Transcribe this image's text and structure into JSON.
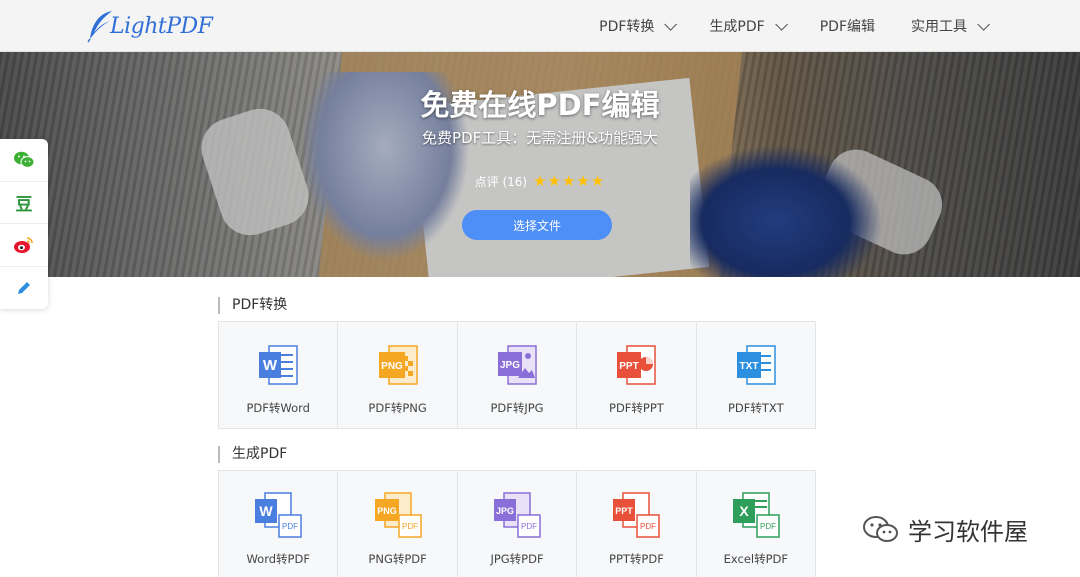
{
  "header": {
    "logo_text": "LightPDF",
    "nav": [
      {
        "label": "PDF转换",
        "has_dropdown": true
      },
      {
        "label": "生成PDF",
        "has_dropdown": true
      },
      {
        "label": "PDF编辑",
        "has_dropdown": false
      },
      {
        "label": "实用工具",
        "has_dropdown": true
      }
    ]
  },
  "hero": {
    "title": "免费在线PDF编辑",
    "subtitle": "免费PDF工具：无需注册&功能强大",
    "rating_label": "点评 (16)",
    "stars": "★★★★★",
    "cta_label": "选择文件"
  },
  "share": {
    "items": [
      {
        "icon": "wechat-icon"
      },
      {
        "icon": "douban-icon",
        "glyph": "豆"
      },
      {
        "icon": "weibo-icon"
      },
      {
        "icon": "edit-icon"
      }
    ]
  },
  "sections": [
    {
      "title": "PDF转换",
      "tools": [
        {
          "label": "PDF转Word",
          "badge": "W",
          "color": "#4a7fe0"
        },
        {
          "label": "PDF转PNG",
          "badge": "PNG",
          "color": "#f5a623"
        },
        {
          "label": "PDF转JPG",
          "badge": "JPG",
          "color": "#8a6fd8"
        },
        {
          "label": "PDF转PPT",
          "badge": "PPT",
          "color": "#e8503a"
        },
        {
          "label": "PDF转TXT",
          "badge": "TXT",
          "color": "#2d8fe0"
        }
      ]
    },
    {
      "title": "生成PDF",
      "tools": [
        {
          "label": "Word转PDF",
          "badge": "W",
          "color": "#4a7fe0"
        },
        {
          "label": "PNG转PDF",
          "badge": "PNG",
          "color": "#f5a623"
        },
        {
          "label": "JPG转PDF",
          "badge": "JPG",
          "color": "#8a6fd8"
        },
        {
          "label": "PPT转PDF",
          "badge": "PPT",
          "color": "#e8503a"
        },
        {
          "label": "Excel转PDF",
          "badge": "X",
          "color": "#2e9e5b"
        }
      ]
    }
  ],
  "watermark": {
    "text": "学习软件屋"
  }
}
